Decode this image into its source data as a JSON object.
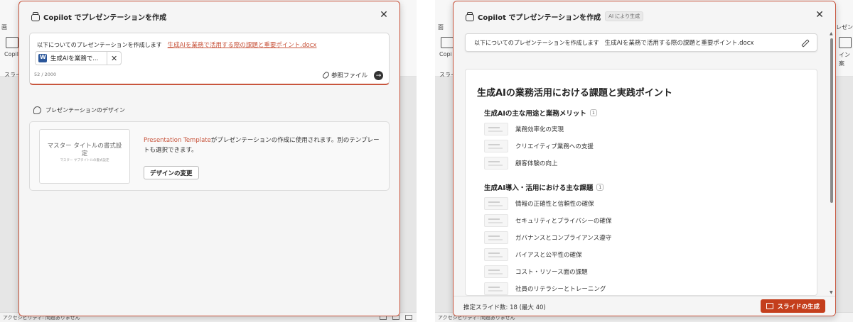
{
  "background": {
    "left_ribbon": {
      "label_a": "画",
      "label_b": "Copilo",
      "label_c": "スライ"
    },
    "right_ribbon": {
      "label_a": "面",
      "label_b": "Copi",
      "label_c": "スライ",
      "label_d": "プレゼン",
      "label_e": "イン",
      "label_f": "案"
    },
    "left_status": "アクセシビリティ: 問題ありません",
    "right_status": "アクセシビリティ: 問題ありません"
  },
  "left_dialog": {
    "title": "Copilot でプレゼンテーションを作成",
    "prompt_prefix": "以下についてのプレゼンテーションを作成します",
    "prompt_file_link": "生成AIを業務で活用する際の課題と重要ポイント.docx",
    "file_chip_label": "生成AIを業務で...",
    "char_count": "52 / 2000",
    "reference_file_label": "参照ファイル",
    "design_heading": "プレゼンテーションのデザイン",
    "thumbnail_title": "マスター タイトルの書式設定",
    "thumbnail_subtitle": "マスター サブタイトルの書式設定",
    "design_template_name": "Presentation Template",
    "design_description": "がプレゼンテーションの作成に使用されます。別のテンプレートも選択できます。",
    "design_change_button": "デザインの変更"
  },
  "right_dialog": {
    "title": "Copilot でプレゼンテーションを作成",
    "ai_badge": "AI により生成",
    "prompt_prefix": "以下についてのプレゼンテーションを作成します",
    "prompt_file": "生成AIを業務で活用する際の課題と重要ポイント.docx",
    "outline": {
      "title": "生成AIの業務活用における課題と実践ポイント",
      "sections": [
        {
          "heading": "生成AIの主な用途と業務メリット",
          "citation": "1",
          "items": [
            "業務効率化の実現",
            "クリエイティブ業務への支援",
            "顧客体験の向上"
          ]
        },
        {
          "heading": "生成AI導入・活用における主な課題",
          "citation": "1",
          "items": [
            "情報の正確性と信頼性の確保",
            "セキュリティとプライバシーの確保",
            "ガバナンスとコンプライアンス遵守",
            "バイアスと公平性の確保",
            "コスト・リソース面の課題",
            "社員のリテラシーとトレーニング"
          ]
        }
      ]
    },
    "slide_count": "推定スライド数: 18 (最大 40)",
    "generate_button": "スライドの生成"
  },
  "colors": {
    "accent": "#c8553d",
    "generate_button": "#c43e1c",
    "word_blue": "#2b579a"
  }
}
